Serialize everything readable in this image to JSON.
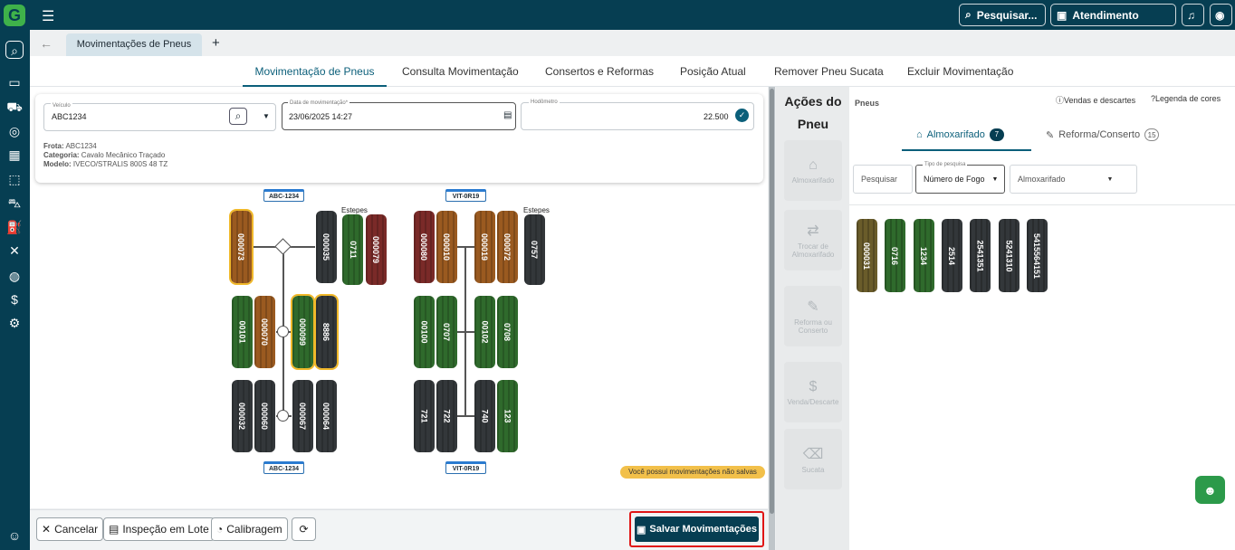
{
  "topbar": {
    "search_label": "Pesquisar...",
    "service_label": "Atendimento"
  },
  "tabs": {
    "open_tab": "Movimentações de Pneus",
    "add": "+"
  },
  "nav": [
    "Movimentação de Pneus",
    "Consulta Movimentação",
    "Consertos e Reformas",
    "Posição Atual",
    "Remover Pneu Sucata",
    "Excluir Movimentação"
  ],
  "vehicle": {
    "vehicle_label": "Veículo",
    "vehicle_value": "ABC1234",
    "date_label": "Data de movimentação*",
    "date_value": "23/06/2025 14:27",
    "odometer_label": "Hodômetro",
    "odometer_value": "22.500",
    "frota_label": "Frota:",
    "frota": "ABC1234",
    "categoria_label": "Categoria:",
    "categoria": "Cavalo Mecânico Traçado",
    "modelo_label": "Modelo:",
    "modelo": "IVECO/STRALIS 800S 48 TZ"
  },
  "diagram": {
    "plate1": "ABC-1234",
    "plate2": "VIT-0R19",
    "estepes": "Estepes",
    "truck1": {
      "row1": [
        "000073",
        "000035"
      ],
      "spares": [
        "0711",
        "000079"
      ],
      "row2": [
        "00101",
        "000070",
        "000099",
        "8886"
      ],
      "row3": [
        "000032",
        "000060",
        "000067",
        "000064"
      ]
    },
    "truck2": {
      "row1": [
        "000080",
        "000010",
        "000019",
        "000072"
      ],
      "spares": [
        "0757"
      ],
      "row2": [
        "00100",
        "0707",
        "00102",
        "0708"
      ],
      "row3": [
        "721",
        "722",
        "740",
        "123"
      ]
    }
  },
  "warning": "Você possui movimentações não salvas",
  "bottom": {
    "cancel": "Cancelar",
    "lote": "Inspeção em Lote",
    "calibragem": "Calibragem",
    "save": "Salvar Movimentações"
  },
  "acoes": {
    "title": "Ações do Pneu",
    "items": [
      "Almoxarifado",
      "Trocar de Almoxarifado",
      "Reforma ou Conserto",
      "Venda/Descarte",
      "Sucata"
    ]
  },
  "right": {
    "title": "Pneus",
    "vendas": "Vendas e descartes",
    "legenda": "Legenda de cores",
    "tab1": "Almoxarifado",
    "tab1_count": "7",
    "tab2": "Reforma/Conserto",
    "tab2_count": "15",
    "search_placeholder": "Pesquisar",
    "tipo_label": "Tipo de pesquisa",
    "tipo_value": "Número de Fogo",
    "almox_placeholder": "Almoxarifado",
    "tires": [
      "000031",
      "0716",
      "1234",
      "2514",
      "2541351",
      "5241310",
      "5415564151"
    ]
  }
}
